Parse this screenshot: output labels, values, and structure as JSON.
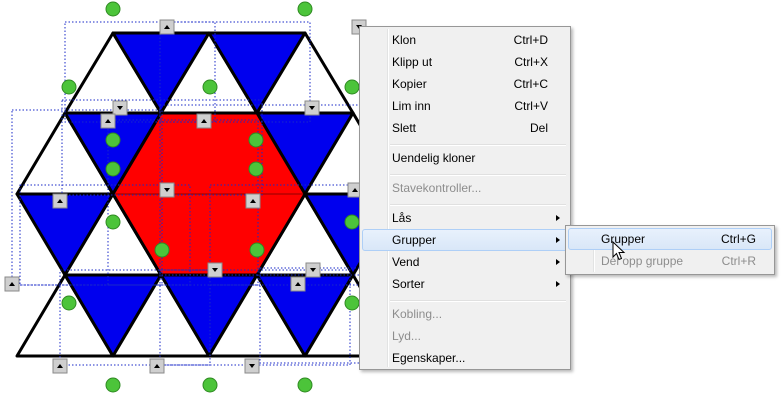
{
  "context_menu": {
    "items": [
      {
        "label": "Klon",
        "shortcut": "Ctrl+D",
        "enabled": true
      },
      {
        "label": "Klipp ut",
        "shortcut": "Ctrl+X",
        "enabled": true
      },
      {
        "label": "Kopier",
        "shortcut": "Ctrl+C",
        "enabled": true
      },
      {
        "label": "Lim inn",
        "shortcut": "Ctrl+V",
        "enabled": true
      },
      {
        "label": "Slett",
        "shortcut": "Del",
        "enabled": true
      },
      {
        "label": "Uendelig kloner",
        "enabled": true
      },
      {
        "label": "Stavekontroller...",
        "enabled": false
      },
      {
        "label": "Lås",
        "enabled": true
      },
      {
        "label": "Grupper",
        "enabled": true
      },
      {
        "label": "Vend",
        "enabled": true
      },
      {
        "label": "Sorter",
        "enabled": true
      },
      {
        "label": "Kobling...",
        "enabled": false
      },
      {
        "label": "Lyd...",
        "enabled": false
      },
      {
        "label": "Egenskaper...",
        "enabled": true
      }
    ]
  },
  "submenu_grupper": {
    "items": [
      {
        "label": "Grupper",
        "shortcut": "Ctrl+G",
        "enabled": true
      },
      {
        "label": "Del opp gruppe",
        "shortcut": "Ctrl+R",
        "enabled": false
      }
    ]
  },
  "colors": {
    "triangle_blue": "#0000ee",
    "hexagon_red": "#ff0000",
    "handle_green": "#4cc43a",
    "selection_dots": "#1a2ac8",
    "menu_background": "#f0f0f0",
    "menu_highlight": "#d9e7f8"
  }
}
